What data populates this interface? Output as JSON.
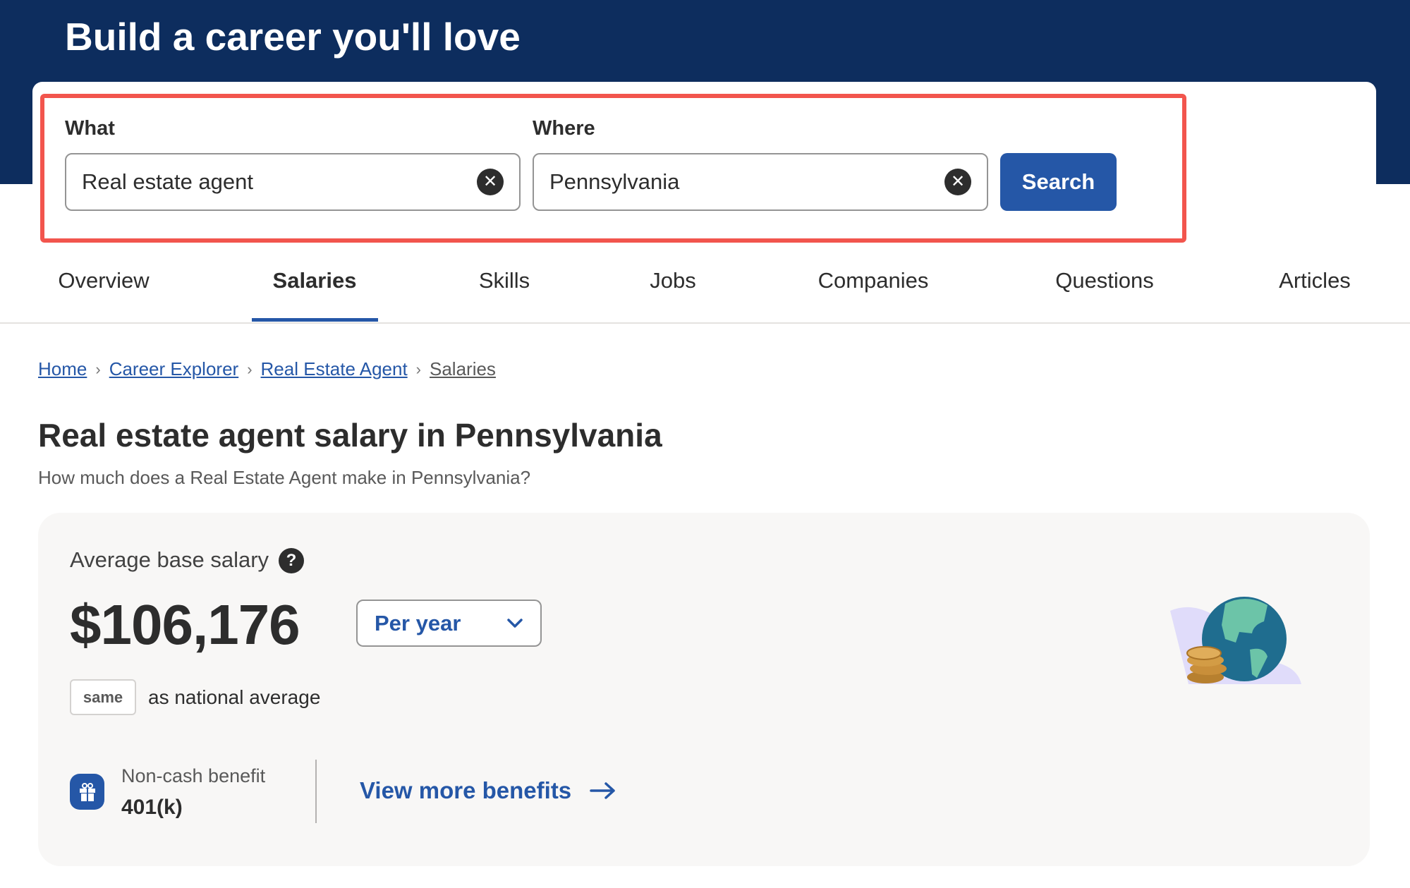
{
  "hero": {
    "title": "Build a career you'll love"
  },
  "search": {
    "what_label": "What",
    "what_value": "Real estate agent",
    "where_label": "Where",
    "where_value": "Pennsylvania",
    "search_label": "Search",
    "clear_icon": "close-circle-icon"
  },
  "tabs": [
    {
      "label": "Overview"
    },
    {
      "label": "Salaries",
      "active": true
    },
    {
      "label": "Skills"
    },
    {
      "label": "Jobs"
    },
    {
      "label": "Companies"
    },
    {
      "label": "Questions"
    },
    {
      "label": "Articles"
    }
  ],
  "breadcrumb": [
    "Home",
    "Career Explorer",
    "Real Estate Agent",
    "Salaries"
  ],
  "page": {
    "title": "Real estate agent salary in Pennsylvania",
    "subtitle": "How much does a Real Estate Agent make in Pennsylvania?"
  },
  "salary": {
    "label": "Average base salary",
    "help": "?",
    "value": "$106,176",
    "period": "Per year",
    "comparison_badge": "same",
    "comparison_text": "as national average",
    "benefit_label": "Non-cash benefit",
    "benefit_value": "401(k)",
    "more_benefits": "View more benefits"
  },
  "colors": {
    "brand_navy": "#0d2d5e",
    "accent_blue": "#2557a7",
    "highlight_red": "#f2554d"
  }
}
